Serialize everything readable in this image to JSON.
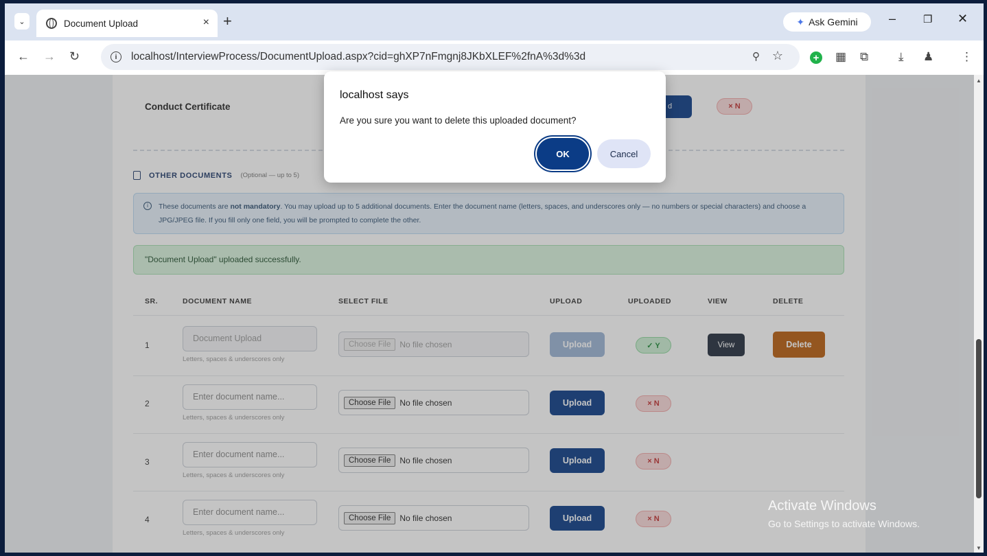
{
  "browser": {
    "tab_title": "Document Upload",
    "tab_close": "×",
    "new_tab": "+",
    "ask_gemini": "Ask Gemini",
    "url": "localhost/InterviewProcess/DocumentUpload.aspx?cid=ghXP7nFmgnj8JKbXLEF%2fnA%3d%3d"
  },
  "page": {
    "conduct_certificate_label": "Conduct Certificate",
    "conduct_upload_partial": "d",
    "conduct_status": "× N",
    "other_documents_title": "OTHER DOCUMENTS",
    "other_documents_optional": "(Optional — up to 5)",
    "info_text_pre": "These documents are ",
    "info_text_bold": "not mandatory",
    "info_text_post": ". You may upload up to 5 additional documents. Enter the document name (letters, spaces, and underscores only — no numbers or special characters) and choose a JPG/JPEG file. If you fill only one field, you will be prompted to complete the other.",
    "success_message": "\"Document Upload\" uploaded successfully.",
    "table_headers": {
      "sr": "SR.",
      "document_name": "DOCUMENT NAME",
      "select_file": "SELECT FILE",
      "upload": "UPLOAD",
      "uploaded": "UPLOADED",
      "view": "VIEW",
      "delete": "DELETE"
    },
    "rows": [
      {
        "sr": "1",
        "name_value": "Document Upload",
        "hint": "Letters, spaces & underscores only",
        "choose_file": "Choose File",
        "file_status": "No file chosen",
        "upload_label": "Upload",
        "uploaded": "✓ Y",
        "view_label": "View",
        "delete_label": "Delete"
      },
      {
        "sr": "2",
        "name_placeholder": "Enter document name...",
        "hint": "Letters, spaces & underscores only",
        "choose_file": "Choose File",
        "file_status": "No file chosen",
        "upload_label": "Upload",
        "uploaded": "× N"
      },
      {
        "sr": "3",
        "name_placeholder": "Enter document name...",
        "hint": "Letters, spaces & underscores only",
        "choose_file": "Choose File",
        "file_status": "No file chosen",
        "upload_label": "Upload",
        "uploaded": "× N"
      },
      {
        "sr": "4",
        "name_placeholder": "Enter document name...",
        "hint": "Letters, spaces & underscores only",
        "choose_file": "Choose File",
        "file_status": "No file chosen",
        "upload_label": "Upload",
        "uploaded": "× N"
      }
    ]
  },
  "dialog": {
    "title": "localhost says",
    "message": "Are you sure you want to delete this uploaded document?",
    "ok_label": "OK",
    "cancel_label": "Cancel"
  },
  "watermark": {
    "line1": "Activate Windows",
    "line2": "Go to Settings to activate Windows."
  },
  "colors": {
    "primary": "#0b3c86",
    "delete": "#b85e0e",
    "success_bg": "#d9f4de",
    "info_bg": "#e6f1fb"
  }
}
